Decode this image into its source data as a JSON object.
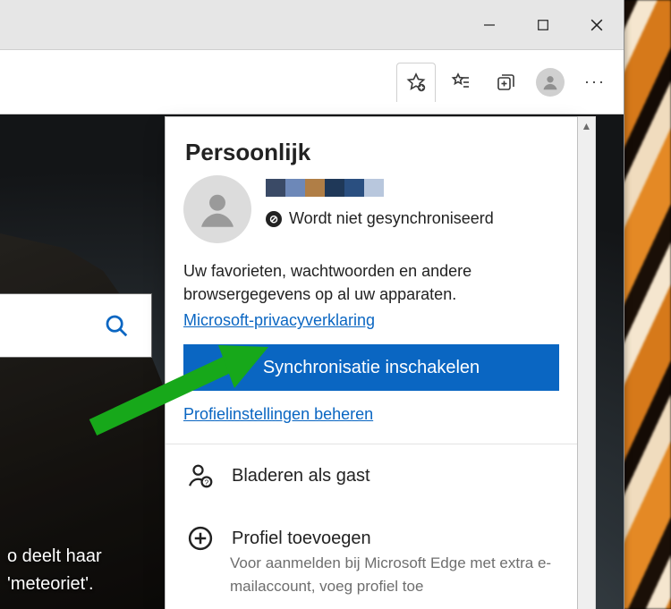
{
  "window": {
    "minimize_name": "minimize",
    "maximize_name": "maximize",
    "close_name": "close"
  },
  "toolbar": {
    "add_fav_name": "add-favorite",
    "favorites_name": "favorites",
    "collections_name": "collections",
    "profile_name": "profile",
    "more_name": "more",
    "more_glyph": "···"
  },
  "content": {
    "caption_line1": "o deelt haar",
    "caption_line2": "'meteoriet'."
  },
  "flyout": {
    "title": "Persoonlijk",
    "name_colors": [
      "#3a4a66",
      "#6d88b8",
      "#b07e46",
      "#1f3858",
      "#2a4f80",
      "#b8c7dd"
    ],
    "sync_status": "Wordt niet gesynchroniseerd",
    "description": "Uw favorieten, wachtwoorden en andere browsergegevens op al uw apparaten.",
    "privacy_link": "Microsoft-privacyverklaring",
    "primary_button": "Synchronisatie inschakelen",
    "manage_link": "Profielinstellingen beheren",
    "guest_label": "Bladeren als gast",
    "add_profile_label": "Profiel toevoegen",
    "add_profile_desc": "Voor aanmelden bij Microsoft Edge met extra e-mailaccount, voeg profiel toe"
  }
}
